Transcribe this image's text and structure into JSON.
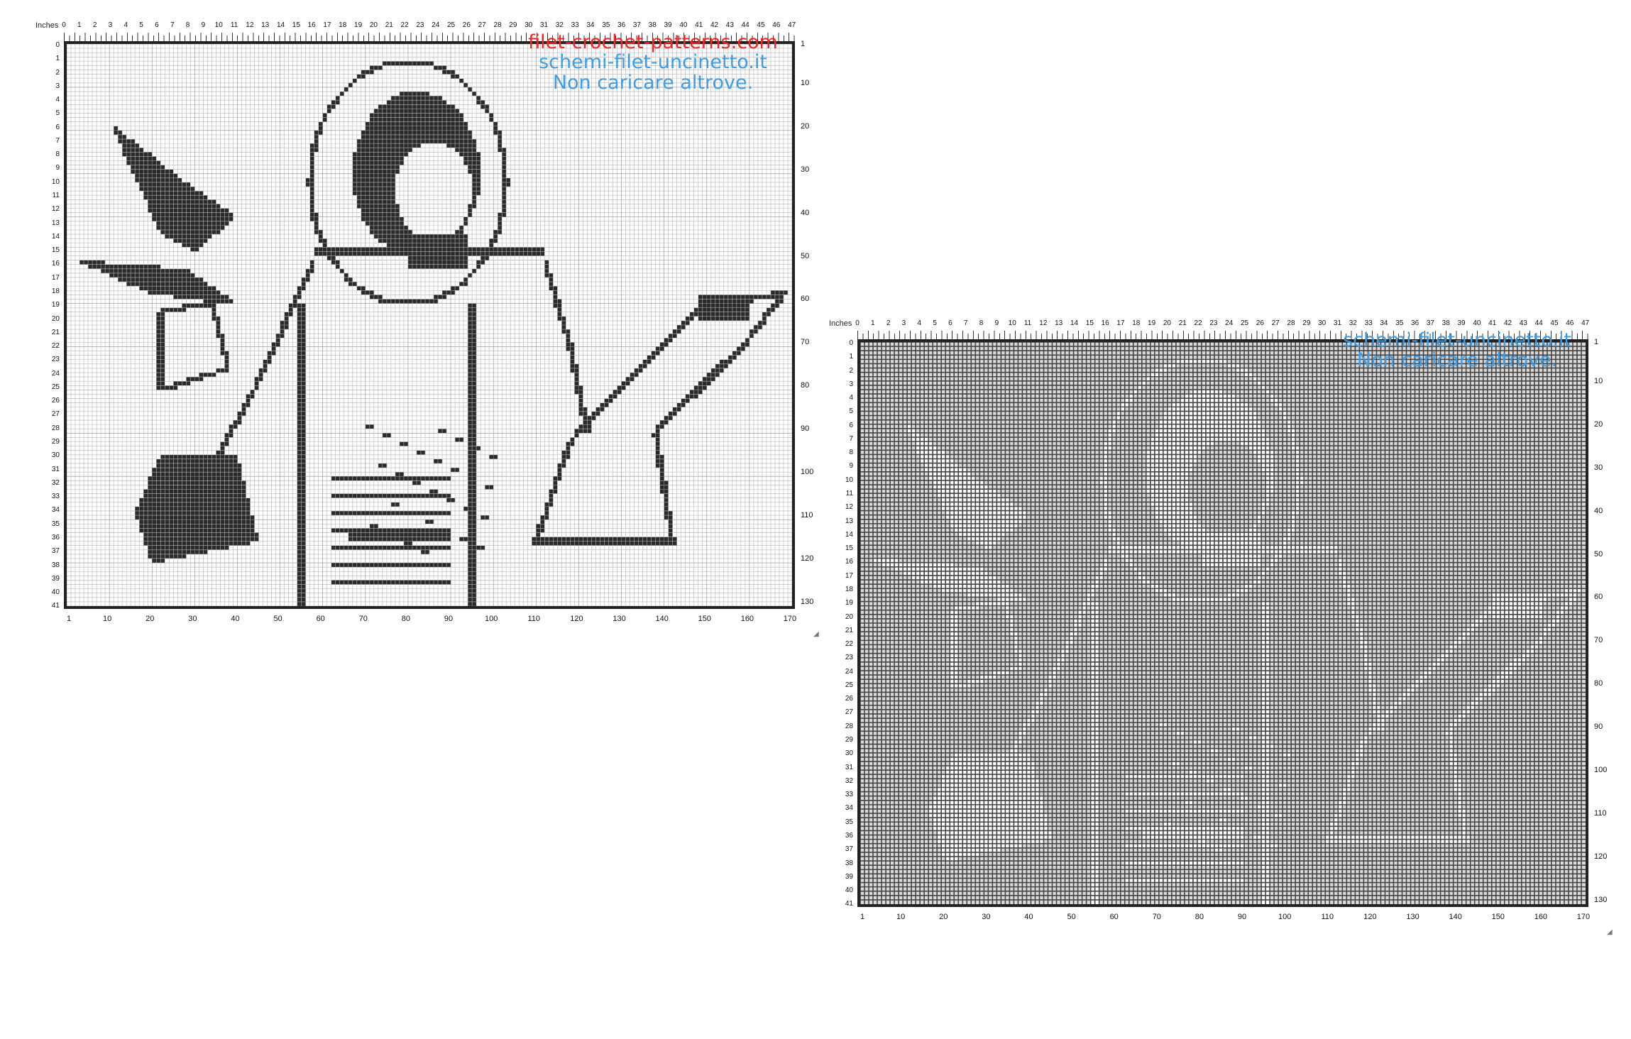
{
  "ruler": {
    "inches_label": "Inches",
    "inch_ticks": [
      "0",
      "1",
      "2",
      "3",
      "4",
      "5",
      "6",
      "7",
      "8",
      "9",
      "10",
      "11",
      "12",
      "13",
      "14",
      "15",
      "16",
      "17",
      "18",
      "19",
      "20",
      "21",
      "22",
      "23",
      "24",
      "25",
      "26",
      "27",
      "28",
      "29",
      "30",
      "31",
      "32",
      "33",
      "34",
      "35",
      "36",
      "37",
      "38",
      "39",
      "40",
      "41",
      "42",
      "43",
      "44",
      "45",
      "46",
      "47"
    ],
    "left_rows": [
      "0",
      "1",
      "2",
      "3",
      "4",
      "5",
      "6",
      "7",
      "8",
      "9",
      "10",
      "11",
      "12",
      "13",
      "14",
      "15",
      "16",
      "17",
      "18",
      "19",
      "20",
      "21",
      "22",
      "23",
      "24",
      "25",
      "26",
      "27",
      "28",
      "29",
      "30",
      "31",
      "32",
      "33",
      "34",
      "35",
      "36",
      "37",
      "38",
      "39",
      "40",
      "41"
    ],
    "right_rows": [
      "1",
      "10",
      "20",
      "30",
      "40",
      "50",
      "60",
      "70",
      "80",
      "90",
      "100",
      "110",
      "120",
      "130"
    ],
    "bottom_cols": [
      "1",
      "10",
      "20",
      "30",
      "40",
      "50",
      "60",
      "70",
      "80",
      "90",
      "100",
      "110",
      "120",
      "130",
      "140",
      "150",
      "160",
      "170"
    ]
  },
  "left_chart": {
    "watermark_line1": "filet-crochet-patterns.com",
    "watermark_line2": "schemi-filet-uncinetto.it",
    "watermark_line3": "Non caricare altrove."
  },
  "right_chart": {
    "watermark_line1": "schemi-filet-uncinetto.it",
    "watermark_line2": "Non caricare altrove."
  },
  "colors": {
    "filled_cell": "#2a2a2a",
    "grid_line": "#b5b5b5",
    "watermark_red": "#ff2020",
    "watermark_blue": "#3d9ce6"
  }
}
